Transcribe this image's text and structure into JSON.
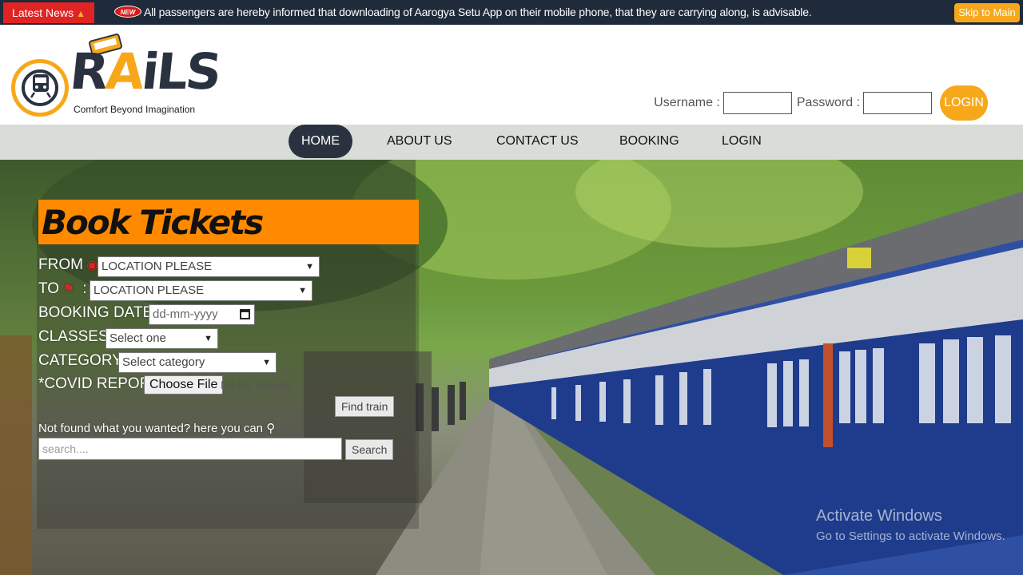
{
  "newsbar": {
    "label": "Latest News",
    "badge": "NEW",
    "text": "All passengers are hereby informed that downloading of Aarogya Setu App on their mobile phone, that they are carrying along, is advisable.",
    "skip_label": "Skip to Main"
  },
  "brand": {
    "name": "RAiLS",
    "tagline": "Comfort Beyond Imagination",
    "primary_color": "#2a3240",
    "accent_color": "#f7a81a"
  },
  "header_login": {
    "username_label": "Username :",
    "password_label": "Password :",
    "login_label": "LOGIN"
  },
  "nav": {
    "items": [
      {
        "label": "HOME",
        "active": true
      },
      {
        "label": "ABOUT US"
      },
      {
        "label": "CONTACT US"
      },
      {
        "label": "BOOKING"
      },
      {
        "label": "LOGIN"
      }
    ]
  },
  "booking": {
    "title": "Book Tickets",
    "from_label": "FROM",
    "to_label": "TO",
    "from_value": "LOCATION PLEASE",
    "to_value": "LOCATION PLEASE",
    "dates_label": "BOOKING DATES",
    "date_placeholder": "dd-mm-yyyy",
    "classes_label": "CLASSES :",
    "classes_value": "Select one",
    "category_label": "CATEGORY :",
    "category_value": "Select category",
    "covid_label": "*COVID REPORT",
    "choose_file_label": "Choose File",
    "no_file_text": "No file chosen",
    "find_train_label": "Find train",
    "notfound_text": "Not found what you wanted? here you can",
    "search_placeholder": "search....",
    "search_label": "Search"
  },
  "watermark": {
    "line1": "Activate Windows",
    "line2": "Go to Settings to activate Windows."
  }
}
